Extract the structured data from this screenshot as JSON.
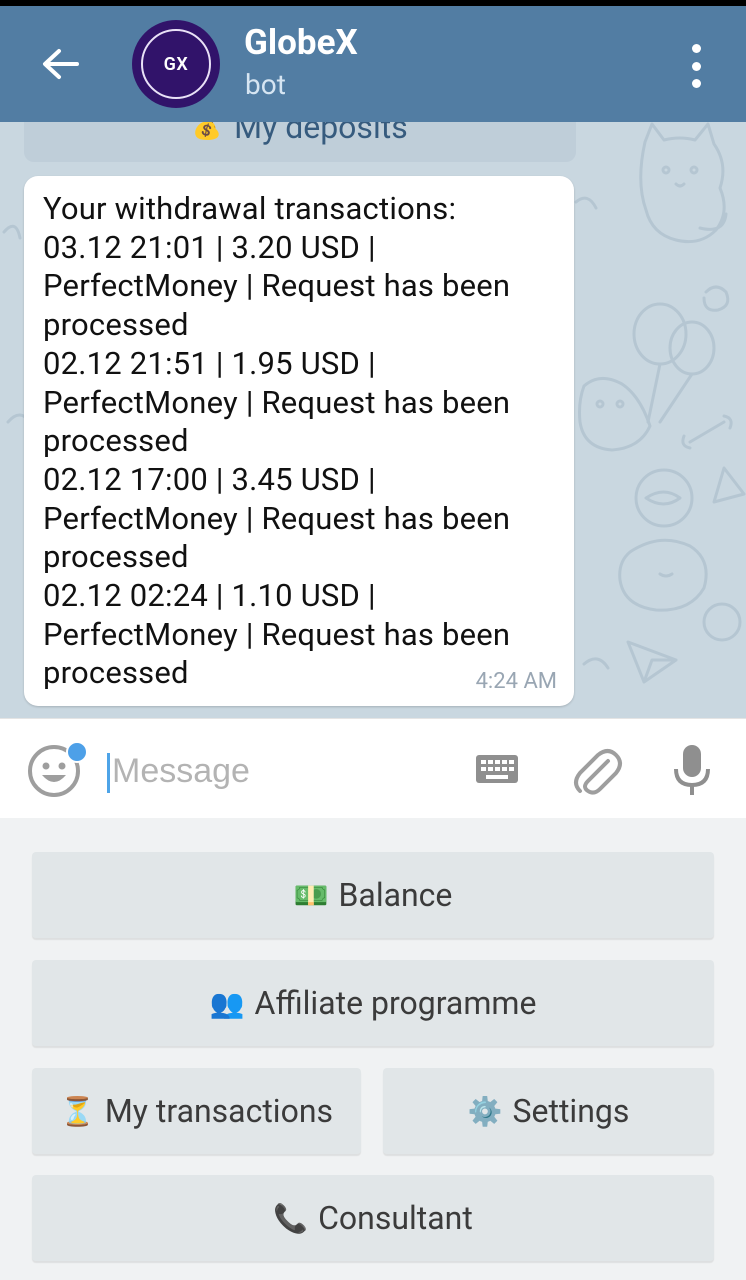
{
  "header": {
    "back_icon": "arrow-left-icon",
    "avatar_initials": "GX",
    "title": "GlobeX",
    "subtitle": "bot",
    "menu_icon": "more-vert-icon",
    "color": "#527da3"
  },
  "chat": {
    "inline_button": {
      "emoji": "💰",
      "label": "My deposits"
    },
    "message": {
      "text": "Your withdrawal transactions:\n03.12 21:01 | 3.20 USD |\nPerfectMoney | Request has been\nprocessed\n02.12 21:51 | 1.95 USD |\nPerfectMoney | Request has been\nprocessed\n02.12 17:00 | 3.45 USD |\nPerfectMoney | Request has been\nprocessed\n02.12 02:24 | 1.10 USD |\nPerfectMoney | Request has been\nprocessed",
      "time": "4:24 AM"
    }
  },
  "input": {
    "placeholder": "Message",
    "value": "",
    "emoji_icon": "smiley-icon",
    "keyboard_icon": "keyboard-icon",
    "attach_icon": "paperclip-icon",
    "mic_icon": "microphone-icon",
    "accent": "#4da0e8"
  },
  "keyboard": {
    "balance": {
      "emoji": "💵",
      "label": "Balance"
    },
    "affiliate": {
      "emoji": "👥",
      "label": "Affiliate programme"
    },
    "transactions": {
      "emoji": "⏳",
      "label": "My transactions"
    },
    "settings": {
      "emoji": "⚙️",
      "label": "Settings"
    },
    "consultant": {
      "emoji": "📞",
      "label": "Consultant"
    }
  }
}
